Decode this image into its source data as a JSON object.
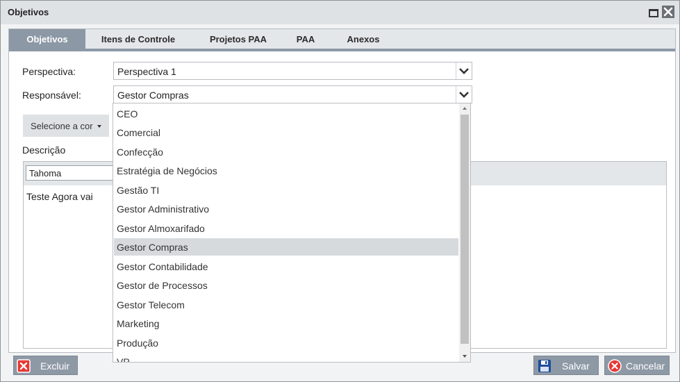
{
  "window": {
    "title": "Objetivos"
  },
  "tabs": [
    {
      "label": "Objetivos",
      "active": true
    },
    {
      "label": "Itens de Controle",
      "active": false
    },
    {
      "label": "Projetos PAA",
      "active": false
    },
    {
      "label": "PAA",
      "active": false
    },
    {
      "label": "Anexos",
      "active": false
    }
  ],
  "form": {
    "perspectiva_label": "Perspectiva:",
    "perspectiva_value": "Perspectiva 1",
    "responsavel_label": "Responsável:",
    "responsavel_value": "Gestor Compras",
    "color_button_label": "Selecione a cor",
    "descricao_label": "Descrição"
  },
  "editor": {
    "font": "Tahoma",
    "content": "Teste Agora vai"
  },
  "dropdown": {
    "items": [
      "CEO",
      "Comercial",
      "Confecção",
      "Estratégia de Negócios",
      "Gestão TI",
      "Gestor Administrativo",
      "Gestor Almoxarifado",
      "Gestor Compras",
      "Gestor Contabilidade",
      "Gestor de Processos",
      "Gestor Telecom",
      "Marketing",
      "Produção",
      "VP"
    ],
    "selected": "Gestor Compras"
  },
  "footer": {
    "delete_label": "Excluir",
    "save_label": "Salvar",
    "cancel_label": "Cancelar"
  },
  "colors": {
    "tab_active": "#8c98a5",
    "button_bg": "#8e99a6",
    "delete_icon": "#e53935",
    "save_icon": "#1f4e9c"
  }
}
